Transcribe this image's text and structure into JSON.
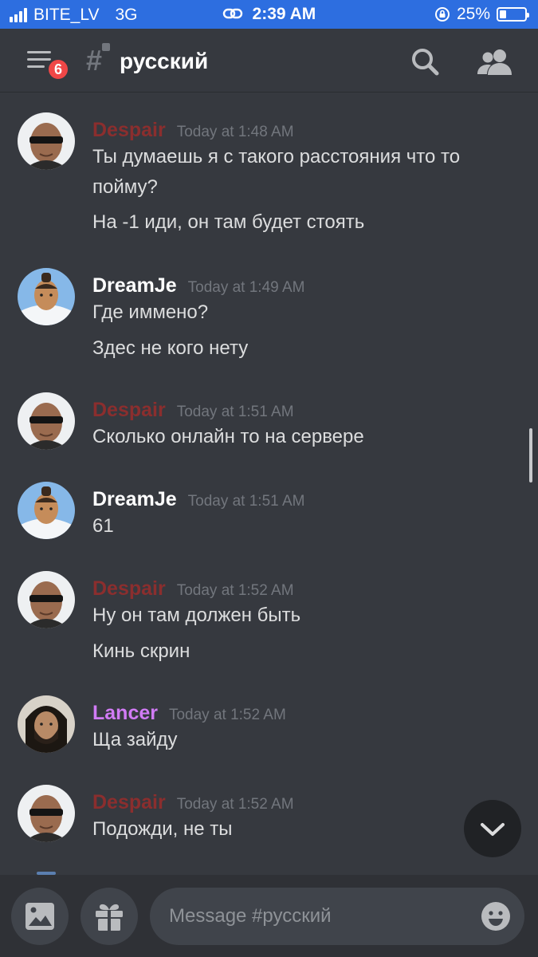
{
  "status_bar": {
    "carrier": "BITE_LV",
    "network": "3G",
    "time": "2:39 AM",
    "battery": "25%",
    "battery_level": 0.25
  },
  "header": {
    "notification_count": "6",
    "channel_name": "русский",
    "icons": {
      "menu": "hamburger-menu-icon",
      "channel": "locked-hash-icon",
      "search": "search-icon",
      "members": "members-icon"
    }
  },
  "messages": [
    {
      "author": "Despair",
      "author_color": "#8b2e2e",
      "time": "Today at 1:48 AM",
      "avatar": "bald-man-sunglasses",
      "lines": [
        "Ты думаешь я с такого расстояния что то пойму?",
        "На -1 иди, он там будет стоять"
      ]
    },
    {
      "author": "DreamJe",
      "author_color": "#ffffff",
      "time": "Today at 1:49 AM",
      "avatar": "cartoon-warrior",
      "lines": [
        "Где иммено?",
        "Здес не кого нету"
      ]
    },
    {
      "author": "Despair",
      "author_color": "#8b2e2e",
      "time": "Today at 1:51 AM",
      "avatar": "bald-man-sunglasses",
      "lines": [
        "Сколько онлайн то на сервере"
      ]
    },
    {
      "author": "DreamJe",
      "author_color": "#ffffff",
      "time": "Today at 1:51 AM",
      "avatar": "cartoon-warrior",
      "lines": [
        "61"
      ]
    },
    {
      "author": "Despair",
      "author_color": "#8b2e2e",
      "time": "Today at 1:52 AM",
      "avatar": "bald-man-sunglasses",
      "lines": [
        "Ну он там должен быть",
        "Кинь скрин"
      ]
    },
    {
      "author": "Lancer",
      "author_color": "#d17bf5",
      "time": "Today at 1:52 AM",
      "avatar": "bearded-man",
      "lines": [
        "Ща зайду"
      ]
    },
    {
      "author": "Despair",
      "author_color": "#8b2e2e",
      "time": "Today at 1:52 AM",
      "avatar": "bald-man-sunglasses",
      "lines": [
        "Подожди, не ты"
      ]
    }
  ],
  "composer": {
    "placeholder": "Message #русский",
    "icons": {
      "image": "image-icon",
      "gift": "gift-icon",
      "emoji": "emoji-icon",
      "jump": "chevron-down-icon"
    }
  }
}
